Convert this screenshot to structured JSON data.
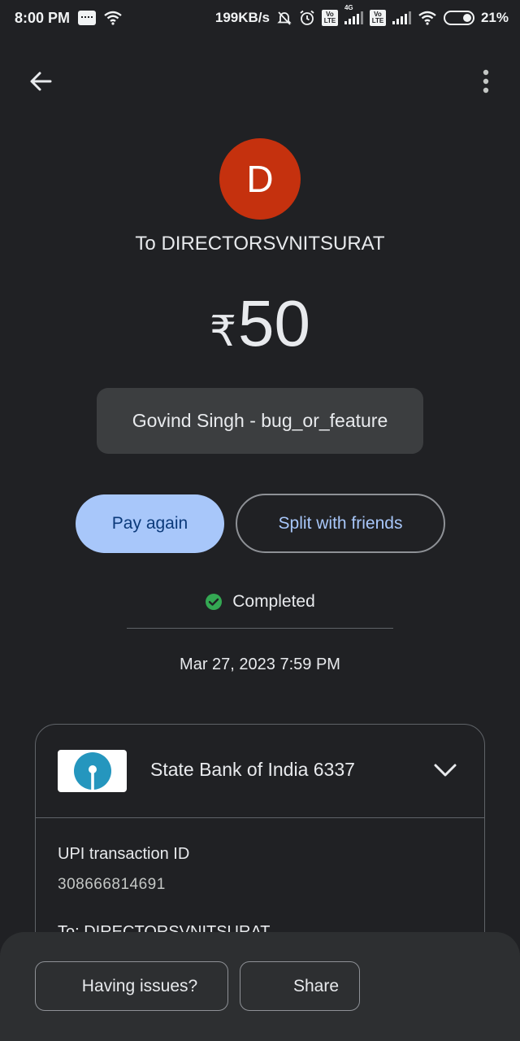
{
  "status_bar": {
    "time": "8:00 PM",
    "net_speed": "199KB/s",
    "network_type": "4G",
    "volte_label": "Vo LTE",
    "battery": "21%",
    "icons": [
      "message-icon",
      "wifi-icon",
      "mute-icon",
      "alarm-icon",
      "signal-icon",
      "battery-icon"
    ]
  },
  "app_bar": {
    "back_icon": "arrow-back-icon",
    "more_icon": "more-vert-icon"
  },
  "header": {
    "avatar_letter": "D",
    "avatar_color": "#c5310e",
    "payee": "To DIRECTORSVNITSURAT",
    "currency": "₹",
    "amount": "50",
    "note": "Govind Singh - bug_or_feature"
  },
  "actions": {
    "pay_again": "Pay again",
    "split": "Split with friends"
  },
  "status": {
    "label": "Completed",
    "color": "#34a853",
    "datetime": "Mar 27, 2023 7:59 PM"
  },
  "details": {
    "bank_name": "State Bank of India 6337",
    "bank_logo": "sbi-logo",
    "upi_label": "UPI transaction ID",
    "upi_id": "308666814691",
    "to_line": "To: DIRECTORSVNITSURAT"
  },
  "footer": {
    "issues": "Having issues?",
    "share": "Share"
  },
  "colors": {
    "background": "#202124",
    "accent": "#a8c7fa",
    "chip": "#3c3e40"
  }
}
